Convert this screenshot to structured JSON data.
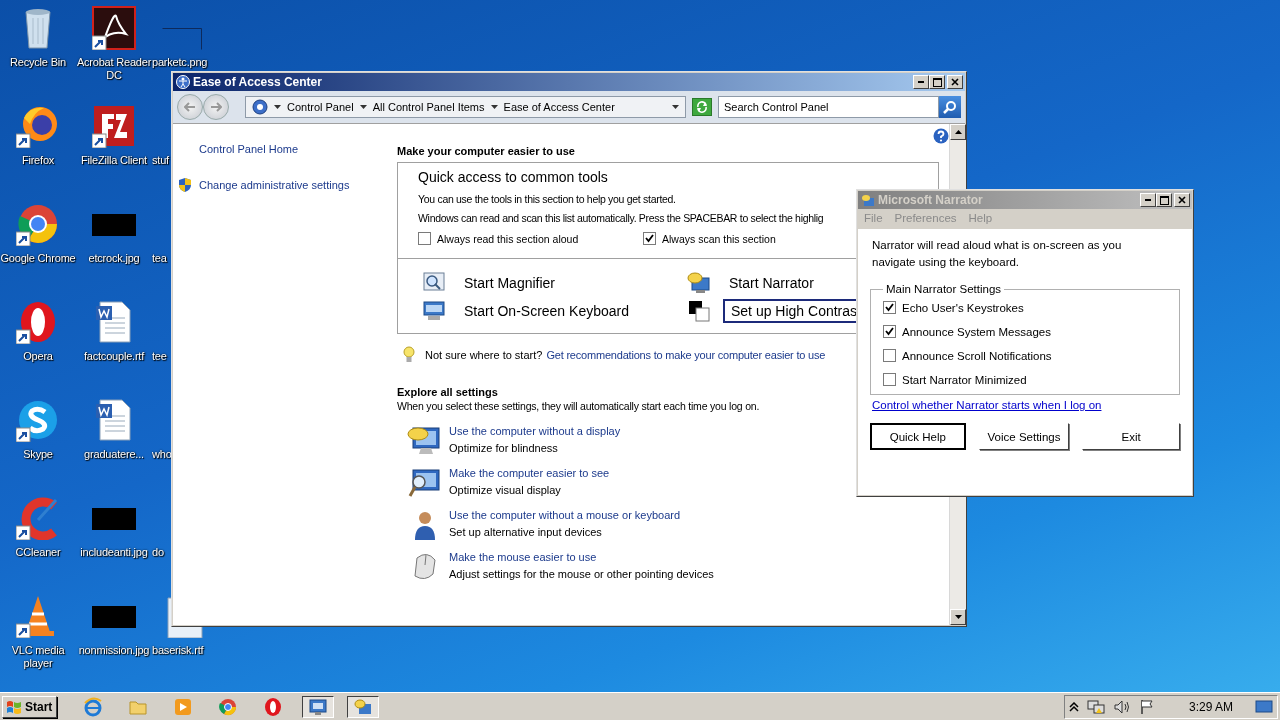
{
  "desktop": {
    "icons": [
      {
        "label": "Recycle Bin",
        "kind": "recycle"
      },
      {
        "label": "Firefox",
        "kind": "firefox"
      },
      {
        "label": "Google Chrome",
        "kind": "chrome"
      },
      {
        "label": "Opera",
        "kind": "opera"
      },
      {
        "label": "Skype",
        "kind": "skype"
      },
      {
        "label": "CCleaner",
        "kind": "ccleaner"
      },
      {
        "label": "VLC media player",
        "kind": "vlc"
      },
      {
        "label": "Acrobat Reader DC",
        "kind": "pdf"
      },
      {
        "label": "FileZilla Client",
        "kind": "filezilla"
      },
      {
        "label": "etcrock.jpg",
        "kind": "blackthumb"
      },
      {
        "label": "factcouple.rtf",
        "kind": "worddoc"
      },
      {
        "label": "graduatere...",
        "kind": "worddoc"
      },
      {
        "label": "includeanti.jpg",
        "kind": "blackthumb"
      },
      {
        "label": "nonmission.jpg",
        "kind": "blackthumb"
      },
      {
        "label": "parketc.png",
        "kind": "outline"
      },
      {
        "label": "stuf",
        "kind": "none"
      },
      {
        "label": "tea",
        "kind": "none"
      },
      {
        "label": "tee",
        "kind": "none"
      },
      {
        "label": "who",
        "kind": "none"
      },
      {
        "label": "do",
        "kind": "none"
      },
      {
        "label": "baserisk.rtf",
        "kind": "doc"
      }
    ]
  },
  "ease_window": {
    "title": "Ease of Access Center",
    "active": true,
    "breadcrumbs": [
      "Control Panel",
      "All Control Panel Items",
      "Ease of Access Center"
    ],
    "search": {
      "placeholder": "Search Control Panel"
    },
    "sidebar": {
      "items": [
        {
          "label": "Control Panel Home",
          "kind": "plain"
        },
        {
          "label": "Change administrative settings",
          "kind": "shield"
        }
      ]
    },
    "heading": "Make your computer easier to use",
    "quick_access": {
      "title": "Quick access to common tools",
      "lines": [
        "You can use the tools in this section to help you get started.",
        "Windows can read and scan this list automatically.  Press the SPACEBAR to select the highlig"
      ],
      "checkboxes": [
        {
          "label": "Always read this section aloud",
          "checked": false
        },
        {
          "label": "Always scan this section",
          "checked": true
        }
      ],
      "tools": [
        {
          "label": "Start Magnifier",
          "kind": "magnifier",
          "focused": false
        },
        {
          "label": "Start On-Screen Keyboard",
          "kind": "keyboard",
          "focused": false
        },
        {
          "label": "Start Narrator",
          "kind": "narrator",
          "focused": false
        },
        {
          "label": "Set up High Contras",
          "kind": "contrast",
          "focused": true
        }
      ]
    },
    "tip": {
      "text": "Not sure where to start?",
      "link": "Get recommendations to make your computer easier to use"
    },
    "explore": {
      "heading": "Explore all settings",
      "description": "When you select these settings, they will automatically start each time you log on.",
      "items": [
        {
          "link": "Use the computer without a display",
          "description": "Optimize for blindness",
          "kind": "display"
        },
        {
          "link": "Make the computer easier to see",
          "description": "Optimize visual display",
          "kind": "see"
        },
        {
          "link": "Use the computer without a mouse or keyboard",
          "description": "Set up alternative input devices",
          "kind": "person"
        },
        {
          "link": "Make the mouse easier to use",
          "description": "Adjust settings for the mouse or other pointing devices",
          "kind": "mouse"
        }
      ]
    }
  },
  "narrator_window": {
    "title": "Microsoft Narrator",
    "active": false,
    "menu": [
      "File",
      "Preferences",
      "Help"
    ],
    "description": "Narrator will read aloud what is on-screen as you navigate using the keyboard.",
    "group": {
      "title": "Main Narrator Settings",
      "options": [
        {
          "label": "Echo User's Keystrokes",
          "checked": true
        },
        {
          "label": "Announce System Messages",
          "checked": true
        },
        {
          "label": "Announce Scroll Notifications",
          "checked": false
        },
        {
          "label": "Start Narrator Minimized",
          "checked": false
        }
      ]
    },
    "link": "Control whether Narrator starts when I log on",
    "buttons": [
      {
        "label": "Quick Help",
        "default": true
      },
      {
        "label": "Voice Settings",
        "default": false
      },
      {
        "label": "Exit",
        "default": false
      }
    ]
  },
  "taskbar": {
    "start": "Start",
    "apps": [
      {
        "kind": "ie",
        "pressed": false
      },
      {
        "kind": "folder",
        "pressed": false
      },
      {
        "kind": "media",
        "pressed": false
      },
      {
        "kind": "chrome",
        "pressed": false
      },
      {
        "kind": "opera",
        "pressed": false
      },
      {
        "kind": "controlpanel",
        "pressed": true
      },
      {
        "kind": "narrator",
        "pressed": true
      }
    ],
    "clock": "3:29 AM"
  }
}
